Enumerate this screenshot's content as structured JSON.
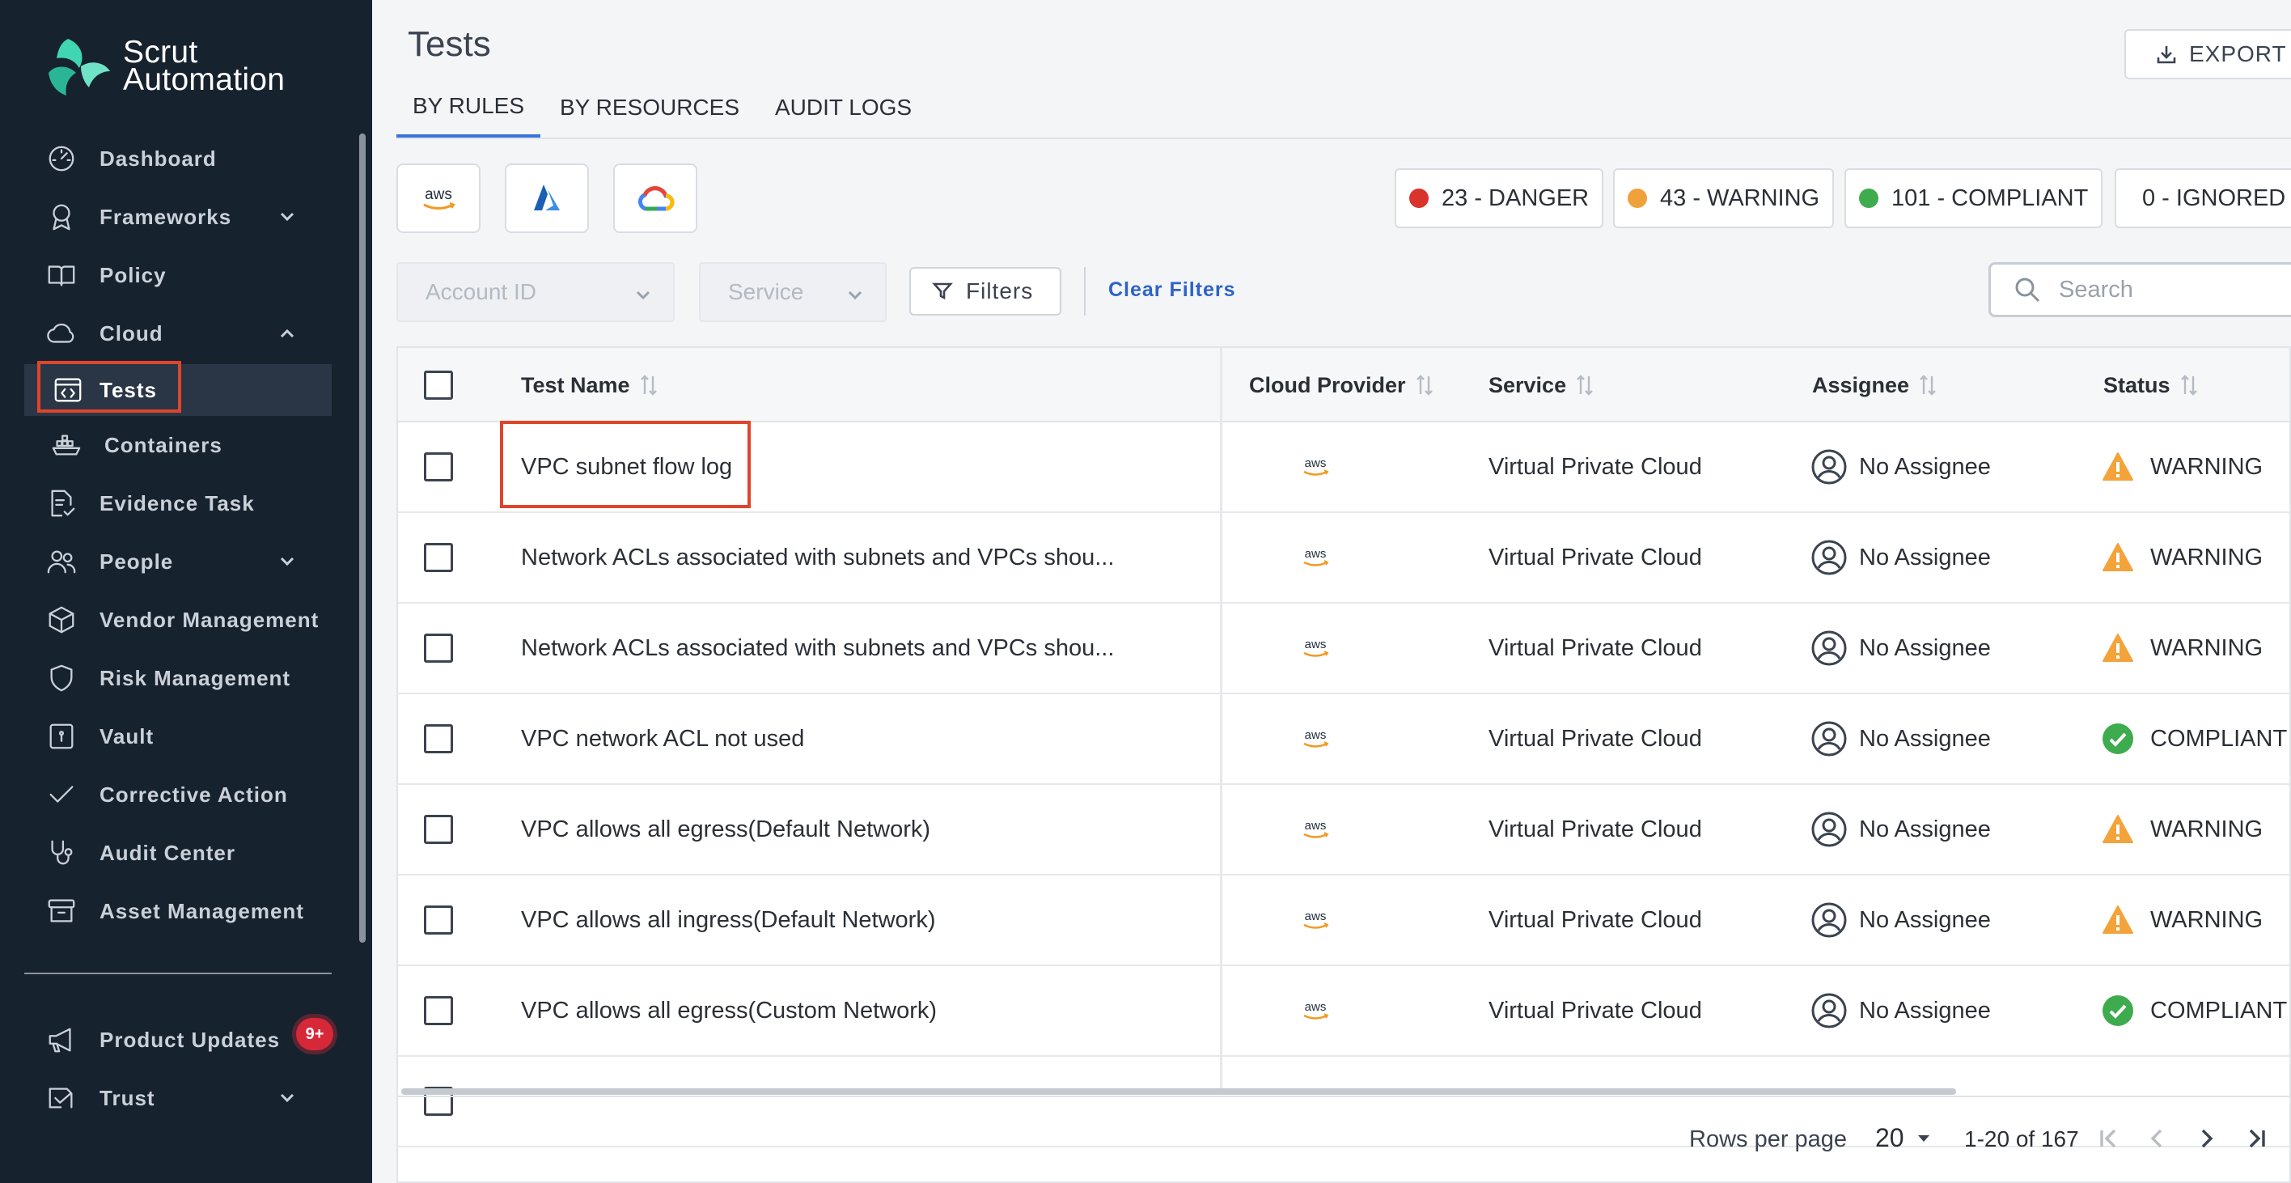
{
  "brand": {
    "line1": "Scrut",
    "line2": "Automation"
  },
  "sidebar": {
    "items": [
      {
        "label": "Dashboard",
        "icon": "dashboard-gauge-icon"
      },
      {
        "label": "Frameworks",
        "icon": "award-ribbon-icon",
        "chevron": "down"
      },
      {
        "label": "Policy",
        "icon": "open-book-icon"
      },
      {
        "label": "Cloud",
        "icon": "cloud-icon",
        "chevron": "up"
      },
      {
        "label": "Tests",
        "icon": "code-brackets-icon",
        "active": true
      },
      {
        "label": "Containers",
        "icon": "container-ship-icon"
      },
      {
        "label": "Evidence Task",
        "icon": "document-check-icon"
      },
      {
        "label": "People",
        "icon": "people-icon",
        "chevron": "down"
      },
      {
        "label": "Vendor Management",
        "icon": "package-box-icon"
      },
      {
        "label": "Risk Management",
        "icon": "shield-icon"
      },
      {
        "label": "Vault",
        "icon": "vault-icon"
      },
      {
        "label": "Corrective Action",
        "icon": "check-icon"
      },
      {
        "label": "Audit Center",
        "icon": "stethoscope-icon"
      },
      {
        "label": "Asset Management",
        "icon": "archive-box-icon"
      },
      {
        "label": "Product Updates",
        "icon": "megaphone-icon",
        "badge": "9+"
      },
      {
        "label": "Trust",
        "icon": "trust-icon",
        "chevron": "down"
      }
    ]
  },
  "header": {
    "title": "Tests",
    "export_label": "EXPORT",
    "tabs": [
      "BY RULES",
      "BY RESOURCES",
      "AUDIT LOGS"
    ]
  },
  "providers": [
    "aws",
    "azure",
    "google-cloud"
  ],
  "status_counts": [
    {
      "label": "23 - DANGER",
      "color": "#d8332c"
    },
    {
      "label": "43 - WARNING",
      "color": "#f0a23a"
    },
    {
      "label": "101 - COMPLIANT",
      "color": "#3eab4e"
    },
    {
      "label": "0 - IGNORED",
      "color": "#2f55e4"
    }
  ],
  "filters": {
    "account_placeholder": "Account ID",
    "service_placeholder": "Service",
    "filters_label": "Filters",
    "clear_label": "Clear Filters",
    "search_placeholder": "Search"
  },
  "table": {
    "columns": [
      "Test Name",
      "Cloud Provider",
      "Service",
      "Assignee",
      "Status"
    ],
    "rows": [
      {
        "name": "VPC subnet flow log",
        "provider": "aws",
        "service": "Virtual Private Cloud",
        "assignee": "No Assignee",
        "status": "WARNING"
      },
      {
        "name": "Network ACLs associated with subnets and VPCs shou...",
        "provider": "aws",
        "service": "Virtual Private Cloud",
        "assignee": "No Assignee",
        "status": "WARNING"
      },
      {
        "name": "Network ACLs associated with subnets and VPCs shou...",
        "provider": "aws",
        "service": "Virtual Private Cloud",
        "assignee": "No Assignee",
        "status": "WARNING"
      },
      {
        "name": "VPC network ACL not used",
        "provider": "aws",
        "service": "Virtual Private Cloud",
        "assignee": "No Assignee",
        "status": "COMPLIANT"
      },
      {
        "name": "VPC allows all egress(Default Network)",
        "provider": "aws",
        "service": "Virtual Private Cloud",
        "assignee": "No Assignee",
        "status": "WARNING"
      },
      {
        "name": "VPC allows all ingress(Default Network)",
        "provider": "aws",
        "service": "Virtual Private Cloud",
        "assignee": "No Assignee",
        "status": "WARNING"
      },
      {
        "name": "VPC allows all egress(Custom Network)",
        "provider": "aws",
        "service": "Virtual Private Cloud",
        "assignee": "No Assignee",
        "status": "COMPLIANT"
      }
    ]
  },
  "pagination": {
    "rows_per_page_label": "Rows per page",
    "rows_per_page": "20",
    "range": "1-20 of 167"
  }
}
